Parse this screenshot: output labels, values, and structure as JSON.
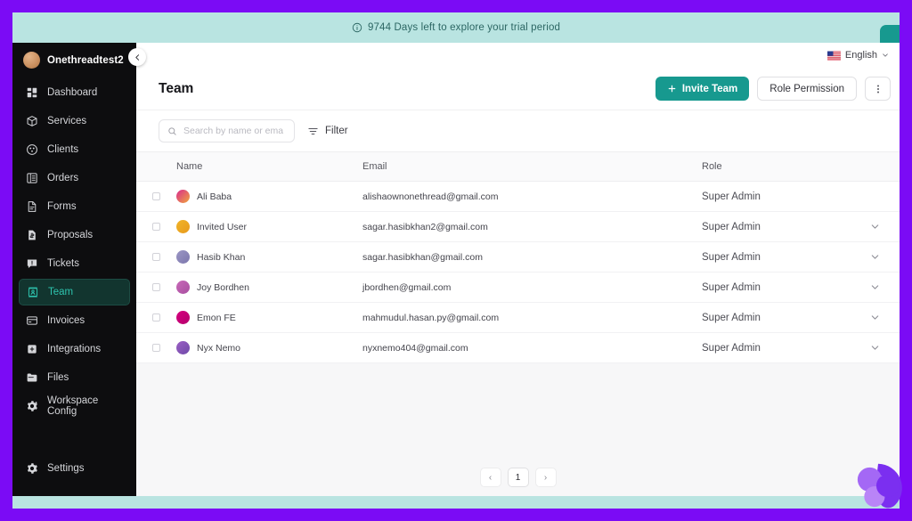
{
  "banner": {
    "text": "9744 Days left to explore your trial period",
    "icon": "info-circle-icon",
    "bg_color": "#b9e4e1",
    "text_color": "#2c6663"
  },
  "sidebar": {
    "workspace": {
      "name": "Onethreadtest2",
      "avatar": "workspace-avatar"
    },
    "collapse_icon": "chevron-left-icon",
    "items": [
      {
        "label": "Dashboard",
        "icon": "dashboard-icon",
        "active": false
      },
      {
        "label": "Services",
        "icon": "services-box-icon",
        "active": false
      },
      {
        "label": "Clients",
        "icon": "clients-icon",
        "active": false
      },
      {
        "label": "Orders",
        "icon": "orders-icon",
        "active": false
      },
      {
        "label": "Forms",
        "icon": "forms-document-icon",
        "active": false
      },
      {
        "label": "Proposals",
        "icon": "proposals-icon",
        "active": false
      },
      {
        "label": "Tickets",
        "icon": "tickets-icon",
        "active": false
      },
      {
        "label": "Team",
        "icon": "team-icon",
        "active": true
      },
      {
        "label": "Invoices",
        "icon": "invoices-card-icon",
        "active": false
      },
      {
        "label": "Integrations",
        "icon": "integrations-icon",
        "active": false
      },
      {
        "label": "Files",
        "icon": "files-folder-icon",
        "active": false
      },
      {
        "label": "Workspace Config",
        "icon": "gear-config-icon",
        "active": false
      }
    ],
    "settings": {
      "label": "Settings",
      "icon": "gear-icon"
    },
    "bg_color": "#0d0d0f",
    "active_color": "#2ec3ae"
  },
  "topbar": {
    "language": "English",
    "language_flag": "us-flag-icon",
    "chevron": "chevron-down-icon"
  },
  "page": {
    "title": "Team"
  },
  "actions": {
    "invite_label": "Invite Team",
    "invite_icon": "plus-icon",
    "role_permission_label": "Role Permission",
    "more_icon": "more-options-icon",
    "primary_color": "#17998f"
  },
  "toolbar": {
    "search_placeholder": "Search by name or email",
    "search_value": "",
    "search_icon": "search-icon",
    "filter_label": "Filter",
    "filter_icon": "filter-icon"
  },
  "table": {
    "columns": [
      "Name",
      "Email",
      "Role"
    ],
    "rows": [
      {
        "name": "Ali Baba",
        "email": "alishaownonethread@gmail.com",
        "role": "Super Admin",
        "avatar_color": "#d92b8e",
        "avatar_color2": "#f0a63c",
        "has_menu": false
      },
      {
        "name": "Invited User",
        "email": "sagar.hasibkhan2@gmail.com",
        "role": "Super Admin",
        "avatar_color": "#f0b429",
        "avatar_color2": "#e89a1c",
        "has_menu": true
      },
      {
        "name": "Hasib Khan",
        "email": "sagar.hasibkhan@gmail.com",
        "role": "Super Admin",
        "avatar_color": "#9b96c4",
        "avatar_color2": "#7d77ad",
        "has_menu": true
      },
      {
        "name": "Joy Bordhen",
        "email": "jbordhen@gmail.com",
        "role": "Super Admin",
        "avatar_color": "#c869b8",
        "avatar_color2": "#a84fa0",
        "has_menu": true
      },
      {
        "name": "Emon FE",
        "email": "mahmudul.hasan.py@gmail.com",
        "role": "Super Admin",
        "avatar_color": "#d6007f",
        "avatar_color2": "#b5006c",
        "has_menu": true
      },
      {
        "name": "Nyx Nemo",
        "email": "nyxnemo404@gmail.com",
        "role": "Super Admin",
        "avatar_color": "#9b5fc4",
        "avatar_color2": "#6f4aa8",
        "has_menu": true
      }
    ],
    "row_menu_icon": "chevron-down-icon"
  },
  "pagination": {
    "prev": "‹",
    "current": "1",
    "next": "›"
  },
  "widget": {
    "name": "chat-bubble-widget",
    "color": "#8b3bf0",
    "color_light": "#b06ff7"
  }
}
